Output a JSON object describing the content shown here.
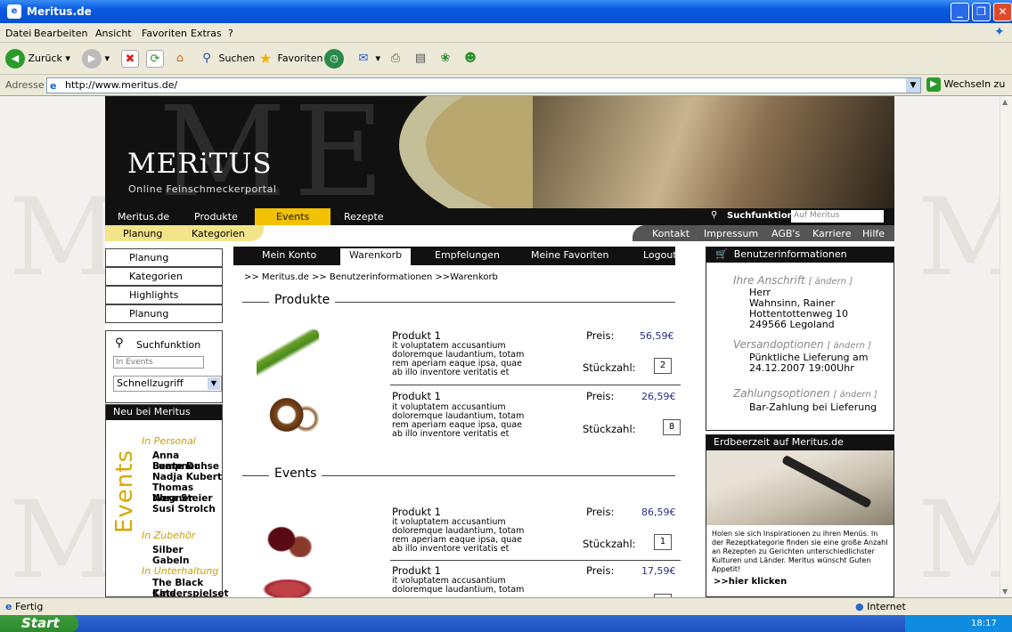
{
  "window": {
    "title": "Meritus.de"
  },
  "menu": [
    "Datei",
    "Bearbeiten",
    "Ansicht",
    "Favoriten",
    "Extras",
    "?"
  ],
  "toolbar": {
    "back": "Zurück",
    "search": "Suchen",
    "favorites": "Favoriten"
  },
  "address": {
    "label": "Adresse",
    "url": "http://www.meritus.de/",
    "go": "Wechseln zu"
  },
  "status": {
    "left": "Fertig",
    "zone": "Internet"
  },
  "taskbar": {
    "start": "Start",
    "clock": "18:17"
  },
  "site": {
    "logo": "MERiTUS",
    "tagline": "Online Feinschmeckerportal",
    "nav1": [
      "Meritus.de",
      "Produkte",
      "Events",
      "Rezepte"
    ],
    "search_label": "Suchfunktion",
    "search_placeholder": "Auf Meritus",
    "nav2_left": [
      "Planung",
      "Kategorien"
    ],
    "nav2_right": [
      "Kontakt",
      "Impressum",
      "AGB's",
      "Karriere",
      "Hilfe"
    ]
  },
  "left": {
    "items": [
      "Planung",
      "Kategorien",
      "Highlights",
      "Planung"
    ],
    "search_label": "Suchfunktion",
    "events_input": "In Events",
    "quick": "Schnellzugriff",
    "neu_title": "Neu bei Meritus",
    "events_vertical": "Events",
    "personal_title": "In Personal",
    "personal": [
      "Anna Lumpner",
      "Beate Duhse",
      "Nadja Kubert",
      "Thomas Wegner",
      "Nora Steier",
      "Susi Strolch"
    ],
    "zubehoer_title": "In Zubehör",
    "zubehoer": [
      "Silber Gabeln"
    ],
    "unterhaltung_title": "In Unterhaltung",
    "unterhaltung": [
      "The Black Cats",
      "Kinderspielset"
    ]
  },
  "tabs": [
    "Mein Konto",
    "Warenkorb",
    "Empfelungen",
    "Meine Favoriten",
    "Logout"
  ],
  "crumb": ">> Meritus.de >> Benutzerinformationen >>Warenkorb",
  "products_title": "Produkte",
  "events_title": "Events",
  "price_label": "Preis:",
  "qty_label": "Stückzahl:",
  "products": [
    {
      "name": "Produkt 1",
      "desc": "it voluptatem accusantium doloremque laudantium, totam rem aperiam eaque ipsa, quae ab illo inventore veritatis et",
      "price": "56,59€",
      "qty": "2"
    },
    {
      "name": "Produkt 1",
      "desc": "it voluptatem accusantium doloremque laudantium, totam rem aperiam eaque ipsa, quae ab illo inventore veritatis et",
      "price": "26,59€",
      "qty": "8"
    }
  ],
  "events": [
    {
      "name": "Produkt 1",
      "desc": "it voluptatem accusantium doloremque laudantium, totam rem aperiam eaque ipsa, quae ab illo inventore veritatis et",
      "price": "86,59€",
      "qty": "1"
    },
    {
      "name": "Produkt 1",
      "desc": "it voluptatem accusantium doloremque laudantium, totam",
      "price": "17,59€",
      "qty": ""
    }
  ],
  "benutzer": {
    "title": "Benutzerinformationen",
    "change": "[ ändern ]",
    "anschrift_title": "Ihre Anschrift",
    "anschrift": [
      "Herr",
      "Wahnsinn, Rainer",
      "Hottentottenweg 10",
      "249566 Legoland"
    ],
    "versand_title": "Versandoptionen",
    "versand": [
      "Pünktliche Lieferung am",
      "24.12.2007 19:00Uhr"
    ],
    "zahlung_title": "Zahlungsoptionen",
    "zahlung": [
      "Bar-Zahlung bei Lieferung"
    ]
  },
  "erd": {
    "title": "Erdbeerzeit auf Meritus.de",
    "text": "Holen sie sich Inspirationen zu ihren Menüs. In der Rezeptkategorie finden sie eine große Anzahl an Rezepten zu Gerichten unterschiedlichster Kulturen und Länder. Meritus wünscht Guten Appetit!",
    "link": ">>hier klicken"
  }
}
